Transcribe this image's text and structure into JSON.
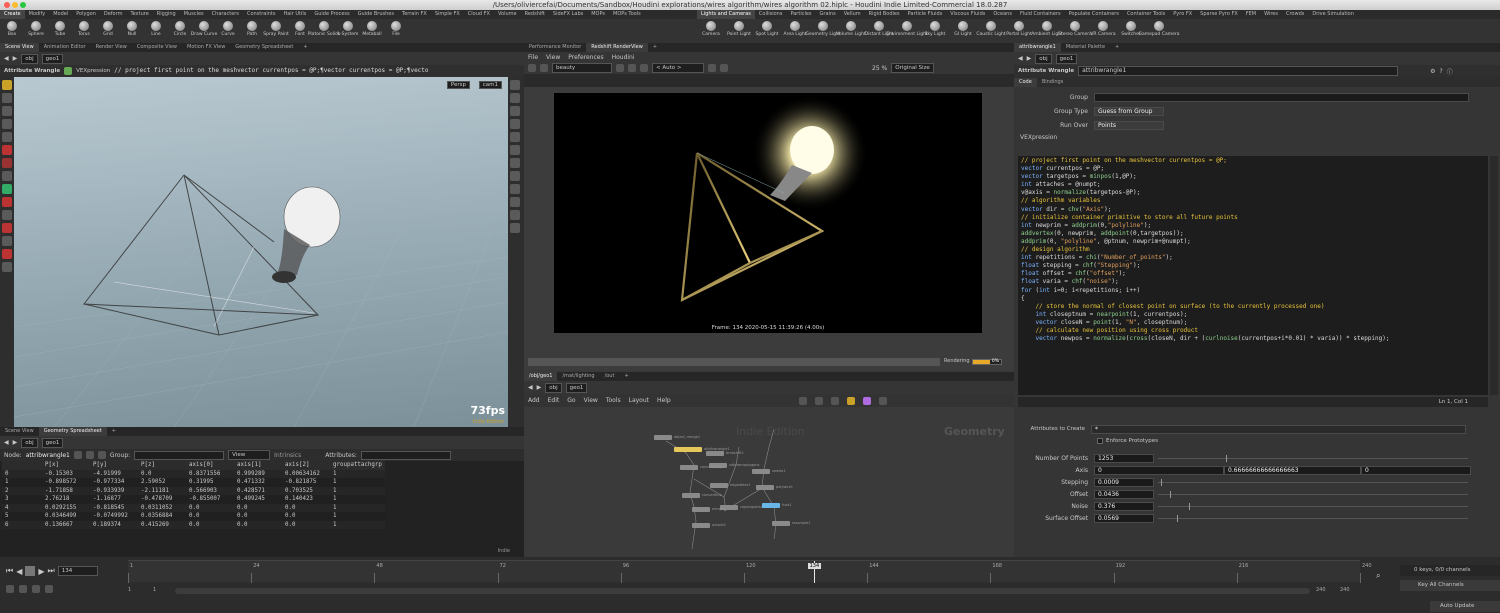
{
  "window": {
    "title": "/Users/oliviercefai/Documents/Sandbox/Houdini explorations/wires algorithm/wires algorithm 02.hiplc - Houdini Indie Limited-Commercial 18.0.287"
  },
  "shelf_tabs_left": [
    "Create",
    "Modify",
    "Model",
    "Polygon",
    "Deform",
    "Texture",
    "Rigging",
    "Muscles",
    "Characters",
    "Constraints",
    "Hair Utils",
    "Guide Process",
    "Guide Brushes",
    "Terrain FX",
    "Simple FX",
    "Cloud FX",
    "Volume",
    "Redshift",
    "SideFX Labs",
    "MOPs",
    "MOPs Tools"
  ],
  "shelf_tabs_right": [
    "Lights and Cameras",
    "Collisions",
    "Particles",
    "Grains",
    "Vellum",
    "Rigid Bodies",
    "Particle Fluids",
    "Viscous Fluids",
    "Oceans",
    "Fluid Containers",
    "Populate Containers",
    "Container Tools",
    "Pyro FX",
    "Sparse Pyro FX",
    "FEM",
    "Wires",
    "Crowds",
    "Drive Simulation"
  ],
  "shelf_tools_left": [
    "Box",
    "Sphere",
    "Tube",
    "Torus",
    "Grid",
    "Null",
    "Line",
    "Circle",
    "Draw Curve",
    "Curve",
    "Path",
    "Spray Paint",
    "Font",
    "Platonic Solids",
    "L-System",
    "Metaball",
    "File"
  ],
  "shelf_tools_right": [
    "Camera",
    "Point Light",
    "Spot Light",
    "Area Light",
    "Geometry Light",
    "Volume Light",
    "Distant Light",
    "Environment Light",
    "Sky Light",
    "GI Light",
    "Caustic Light",
    "Portal Light",
    "Ambient Light",
    "Stereo Camera",
    "VR Camera",
    "Switcher",
    "Gamepad Camera"
  ],
  "viewer": {
    "tabs": [
      "Scene View",
      "Animation Editor",
      "Render View",
      "Composite View",
      "Motion FX View",
      "Geometry Spreadsheet"
    ],
    "path": [
      "obj",
      "geo1"
    ],
    "node_type": "Attribute Wrangle",
    "vex_label": "VEXpression",
    "vex_snippet": "// project first point on the meshvector currentpos = @P;¶vector currentpos = @P;¶vecto",
    "persp": "Persp",
    "cam": "cam1",
    "fps": "73fps",
    "fps_sub": "Indie Edition"
  },
  "spreadsheet": {
    "tabs": [
      "Scene View",
      "Geometry Spreadsheet"
    ],
    "path": [
      "obj",
      "geo1"
    ],
    "node_label": "Node:",
    "node_value": "attribwrangle1",
    "group_label": "Group:",
    "view_label": "View",
    "intrinsics_label": "Intrinsics",
    "attributes_label": "Attributes:",
    "columns": [
      "",
      "P[x]",
      "P[y]",
      "P[z]",
      "axis[0]",
      "axis[1]",
      "axis[2]",
      "groupattachgrp"
    ],
    "rows": [
      [
        "0",
        "-0.15303",
        "-4.91999",
        "0.0",
        "0.8371556",
        "0.999289",
        "0.00634162",
        "1"
      ],
      [
        "1",
        "-0.898572",
        "-0.977334",
        "2.59052",
        "0.31995",
        "0.471332",
        "-0.821875",
        "1"
      ],
      [
        "2",
        "-1.71858",
        "-0.933939",
        "-2.11181",
        "0.566903",
        "0.428571",
        "0.703525",
        "1"
      ],
      [
        "3",
        "2.76218",
        "-1.16877",
        "-0.478709",
        "-0.855007",
        "0.499245",
        "0.140423",
        "1"
      ],
      [
        "4",
        "0.0292155",
        "-0.818545",
        "0.0311052",
        "0.0",
        "0.0",
        "0.0",
        "1"
      ],
      [
        "5",
        "0.0346499",
        "-0.0749992",
        "0.0356884",
        "0.0",
        "0.0",
        "0.0",
        "1"
      ],
      [
        "6",
        "0.136667",
        "0.189374",
        "0.415269",
        "0.0",
        "0.0",
        "0.0",
        "1"
      ]
    ],
    "footer": "Indie"
  },
  "render": {
    "tabs": [
      "Performance Monitor",
      "Redshift RenderView"
    ],
    "menu": [
      "File",
      "View",
      "Preferences",
      "Houdini"
    ],
    "aov": "beauty",
    "auto": "< Auto >",
    "zoom": "25 %",
    "size": "Original Size",
    "caption": "Frame: 134  2020-05-15 11:39:26 (4.00s)",
    "status": "Rendering",
    "progress": 0.6,
    "progress_text": "0%"
  },
  "network": {
    "tabs": [
      "/obj/geo1",
      "/mat/lighting",
      "/out"
    ],
    "path": [
      "obj",
      "geo1"
    ],
    "menu": [
      "Add",
      "Edit",
      "Go",
      "View",
      "Tools",
      "Layout",
      "Help"
    ],
    "watermark_left": "Indie Edition",
    "watermark_right": "Geometry",
    "node_labels": [
      "object_merge1",
      "attribwrangle1",
      "timeshift1",
      "vdbfrompolygons",
      "connectivity",
      "edgedetect",
      "convertline",
      "sweep1",
      "polywire1",
      "copytopoints1",
      "merge1",
      "fuse1",
      "resample1",
      "output0"
    ]
  },
  "params": {
    "tabs": [
      "attribwrangle1",
      "Material Palette"
    ],
    "path": [
      "obj",
      "geo1"
    ],
    "node_type": "Attribute Wrangle",
    "node_name": "attribwrangle1",
    "sub_tabs": [
      "Code",
      "Bindings"
    ],
    "group_label": "Group",
    "group_type_label": "Group Type",
    "group_type_value": "Guess from Group",
    "run_over_label": "Run Over",
    "run_over_value": "Points",
    "vex_label": "VEXpression",
    "code_lines": [
      "// project first point on the meshvector currentpos = @P;",
      "vector currentpos = @P;",
      "vector targetpos = minpos(1,@P);",
      "int attaches = @numpt;",
      "",
      "v@axis = normalize(targetpos-@P);",
      "",
      "// algorithm variables",
      "vector dir = chv(\"Axis\");",
      "",
      "// initialize container primitive to store all future points",
      "int newprim = addprim(0,\"polyline\");",
      "addvertex(0, newprim, addpoint(0,targetpos));",
      "addprim(0, \"polyline\", @ptnum, newprim+@numpt);",
      "",
      "// design algorithm",
      "int repetitions = chi(\"Number_of_points\");",
      "float stepping = chf(\"Stepping\");",
      "float offset = chf(\"offset\");",
      "float varia = chf(\"noise\");",
      "",
      "for (int i=0; i<repetitions; i++)",
      "{",
      "    // store the normal of closest point on surface (to the currently processed one)",
      "    int closeptnum = nearpoint(1, currentpos);",
      "    vector closeN = point(1, \"N\", closeptnum);",
      "",
      "    // calculate new position using cross product",
      "    vector newpos = normalize(cross(closeN, dir + (curlnoise(currentpos+i*0.01) * varia)) * stepping);"
    ],
    "line_col": "Ln 1, Col 1",
    "attrs_create_label": "Attributes to Create",
    "attrs_create_value": "*",
    "enforce_label": "Enforce Prototypes",
    "num_points_label": "Number Of Points",
    "num_points": "1253",
    "num_points_frac": 0.22,
    "axis_label": "Axis",
    "axis": [
      "0",
      "0.66666666666666663",
      "0"
    ],
    "stepping_label": "Stepping",
    "stepping": "0.0009",
    "stepping_frac": 0.01,
    "offset_label": "Offset",
    "offset": "0.0436",
    "offset_frac": 0.04,
    "noise_label": "Noise",
    "noise": "0.376",
    "noise_frac": 0.1,
    "surface_label": "Surface Offset",
    "surface": "0.0569",
    "surface_frac": 0.06
  },
  "timeline": {
    "frame": "134",
    "ticks": [
      "1",
      "24",
      "48",
      "72",
      "96",
      "120",
      "144",
      "168",
      "192",
      "216",
      "240"
    ],
    "start": "1",
    "start2": "1",
    "end": "240",
    "end2": "240",
    "keys": "0 keys, 0/0 channels",
    "key_all": "Key All Channels",
    "auto_update": "Auto Update"
  }
}
